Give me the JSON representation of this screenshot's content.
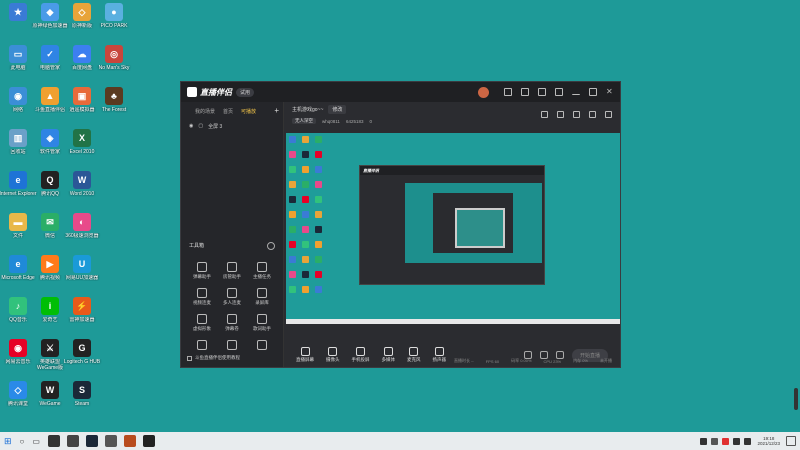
{
  "desktop": {
    "icons": [
      {
        "label": "",
        "color": "#3a7bd5",
        "glyph": "★"
      },
      {
        "label": "原神绿色加速器",
        "color": "#4a9be8",
        "glyph": "◆"
      },
      {
        "label": "原神新版",
        "color": "#e8a43a",
        "glyph": "◇"
      },
      {
        "label": "PICO PARK",
        "color": "#5ab0e0",
        "glyph": "●"
      },
      {
        "label": "此电脑",
        "color": "#3b8ed6",
        "glyph": "▭"
      },
      {
        "label": "电脑管家",
        "color": "#2f84e4",
        "glyph": "✓"
      },
      {
        "label": "百度网盘",
        "color": "#3c7ff0",
        "glyph": "☁"
      },
      {
        "label": "No Man's Sky",
        "color": "#c8463c",
        "glyph": "◎"
      },
      {
        "label": "网络",
        "color": "#3b8ed6",
        "glyph": "◉"
      },
      {
        "label": "斗鱼直播伴侣",
        "color": "#f0a030",
        "glyph": "▲"
      },
      {
        "label": "逍遥模拟器",
        "color": "#e86a3a",
        "glyph": "▣"
      },
      {
        "label": "The Forest",
        "color": "#5a3a20",
        "glyph": "♣"
      },
      {
        "label": "回收站",
        "color": "#6aa0c8",
        "glyph": "▥"
      },
      {
        "label": "软件管家",
        "color": "#2f84e4",
        "glyph": "◈"
      },
      {
        "label": "Excel 2010",
        "color": "#217346",
        "glyph": "X"
      },
      {
        "label": "",
        "color": "",
        "glyph": ""
      },
      {
        "label": "Internet Explorer",
        "color": "#1e73d6",
        "glyph": "e"
      },
      {
        "label": "腾讯QQ",
        "color": "#222",
        "glyph": "Q"
      },
      {
        "label": "Word 2010",
        "color": "#2b5797",
        "glyph": "W"
      },
      {
        "label": "",
        "color": "",
        "glyph": ""
      },
      {
        "label": "文件",
        "color": "#e8b84a",
        "glyph": "▬"
      },
      {
        "label": "微信",
        "color": "#2aae67",
        "glyph": "✉"
      },
      {
        "label": "360极速浏览器",
        "color": "#e84a8a",
        "glyph": "◐"
      },
      {
        "label": "",
        "color": "",
        "glyph": ""
      },
      {
        "label": "Microsoft Edge",
        "color": "#1f8ad8",
        "glyph": "e"
      },
      {
        "label": "腾讯视频",
        "color": "#ff7a1a",
        "glyph": "▶"
      },
      {
        "label": "网易UU加速器",
        "color": "#1a9ad8",
        "glyph": "U"
      },
      {
        "label": "",
        "color": "",
        "glyph": ""
      },
      {
        "label": "QQ音乐",
        "color": "#31c27c",
        "glyph": "♪"
      },
      {
        "label": "爱奇艺",
        "color": "#00be06",
        "glyph": "i"
      },
      {
        "label": "雷神加速器",
        "color": "#e85a1a",
        "glyph": "⚡"
      },
      {
        "label": "",
        "color": "",
        "glyph": ""
      },
      {
        "label": "网易云音乐",
        "color": "#e60026",
        "glyph": "◉"
      },
      {
        "label": "英雄联盟 WeGame版",
        "color": "#222",
        "glyph": "⚔"
      },
      {
        "label": "Logitech G HUB",
        "color": "#222",
        "glyph": "G"
      },
      {
        "label": "",
        "color": "",
        "glyph": ""
      },
      {
        "label": "腾讯课堂",
        "color": "#2a8ae8",
        "glyph": "◇"
      },
      {
        "label": "WeGame",
        "color": "#222",
        "glyph": "W"
      },
      {
        "label": "Steam",
        "color": "#1b2838",
        "glyph": "S"
      }
    ]
  },
  "app": {
    "title": "直播伴侣",
    "version_badge": "试用",
    "tabs": [
      "我的场景",
      "首页",
      "可播放"
    ],
    "active_tab": "可播放",
    "scene_label": "全屏 3",
    "tools_title": "工具箱",
    "tools": [
      {
        "label": "弹幕助手"
      },
      {
        "label": "房管助手"
      },
      {
        "label": "主播任务"
      },
      {
        "label": "视频连麦"
      },
      {
        "label": "多人连麦"
      },
      {
        "label": "录屏库"
      },
      {
        "label": "虚拟形象"
      },
      {
        "label": "弹幕卷"
      },
      {
        "label": "歌词助手"
      },
      {
        "label": ""
      },
      {
        "label": ""
      },
      {
        "label": ""
      }
    ],
    "footer_text": "斗鱼直播伴侣使用教程",
    "room": {
      "name": "主机游戏go~~",
      "edit_label": "修改",
      "category": "无人深空",
      "room_label": "whq0811",
      "room_id": "6425183",
      "fans": "0"
    },
    "controls": [
      {
        "label": "直播屏幕"
      },
      {
        "label": "摄像头"
      },
      {
        "label": "手机投屏"
      },
      {
        "label": "多媒体"
      },
      {
        "label": "麦克风"
      },
      {
        "label": "扬声器"
      }
    ],
    "start_live_label": "开始直播",
    "status": [
      "直播时长 --",
      "FPS 60",
      "码率 0.00%",
      "CPU 23%",
      "内存 0%",
      "未开播"
    ]
  },
  "taskbar": {
    "time": "19:18",
    "date": "2021/12/23",
    "tray_colors": [
      "#333",
      "#555",
      "#e03030",
      "#333",
      "#333"
    ],
    "pinned_colors": [
      "#333",
      "#444",
      "#1b2838",
      "#555",
      "#b84c1e",
      "#222"
    ]
  }
}
